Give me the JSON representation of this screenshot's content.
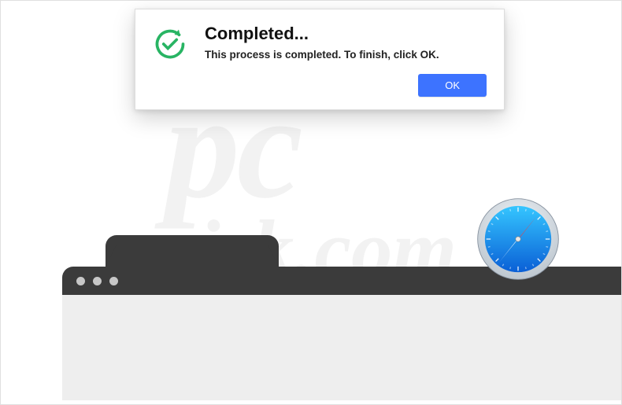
{
  "watermark": {
    "line1": "pc",
    "line2": "risk.com"
  },
  "dialog": {
    "title": "Completed...",
    "message": "This process is completed. To finish, click OK.",
    "ok_label": "OK",
    "icon": "checkmark-refresh"
  },
  "compass_icon": "safari-compass",
  "colors": {
    "accent_button": "#3d73ff",
    "toolbar_bg": "#3b3b3b",
    "viewport_bg": "#eeeeee",
    "check_green": "#28b463"
  }
}
